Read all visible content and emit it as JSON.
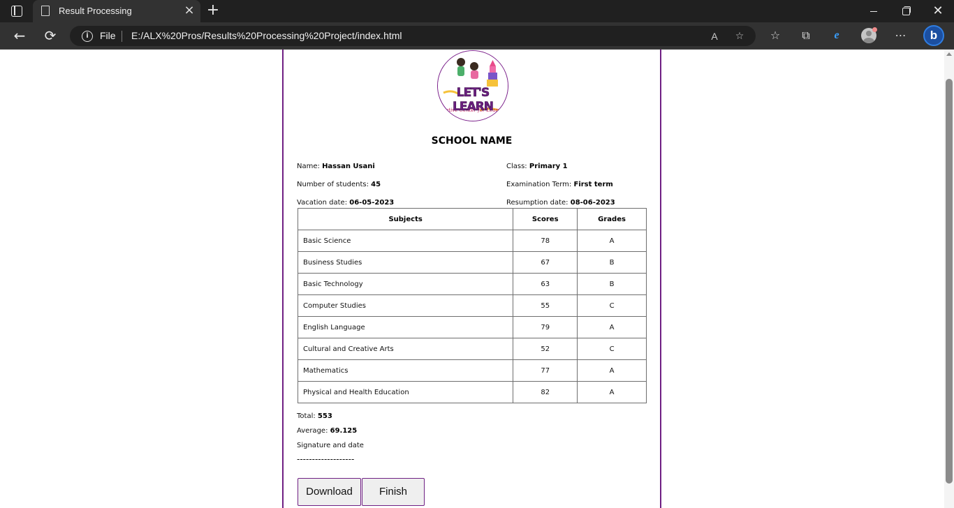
{
  "browser": {
    "tab_title": "Result Processing",
    "tab_close": "×",
    "new_tab": "+",
    "address_scheme": "File",
    "address_url": "E:/ALX%20Pros/Results%20Processing%20Project/index.html",
    "win_close": "✕",
    "icons": {
      "back": "←",
      "reload": "⟳",
      "info": "i",
      "read_aloud": "A",
      "favorite_add": "☆",
      "favorites": "☆",
      "collections": "⧉",
      "edge_ie": "e",
      "menu": "⋯",
      "bing": "b"
    }
  },
  "page": {
    "logo_text": "LET'S LEARN",
    "school_name": "SCHOOL NAME",
    "info": {
      "name_label": "Name:",
      "name_value": "Hassan Usani",
      "class_label": "Class:",
      "class_value": "Primary 1",
      "students_label": "Number of students:",
      "students_value": "45",
      "term_label": "Examination Term:",
      "term_value": "First term",
      "vacation_label": "Vacation date:",
      "vacation_value": "06-05-2023",
      "resumption_label": "Resumption date:",
      "resumption_value": "08-06-2023"
    },
    "table": {
      "headers": [
        "Subjects",
        "Scores",
        "Grades"
      ],
      "rows": [
        {
          "subject": "Basic Science",
          "score": "78",
          "grade": "A"
        },
        {
          "subject": "Business Studies",
          "score": "67",
          "grade": "B"
        },
        {
          "subject": "Basic Technology",
          "score": "63",
          "grade": "B"
        },
        {
          "subject": "Computer Studies",
          "score": "55",
          "grade": "C"
        },
        {
          "subject": "English Language",
          "score": "79",
          "grade": "A"
        },
        {
          "subject": "Cultural and Creative Arts",
          "score": "52",
          "grade": "C"
        },
        {
          "subject": "Mathematics",
          "score": "77",
          "grade": "A"
        },
        {
          "subject": "Physical and Health Education",
          "score": "82",
          "grade": "A"
        }
      ]
    },
    "summary": {
      "total_label": "Total:",
      "total_value": "553",
      "average_label": "Average:",
      "average_value": "69.125",
      "signature_label": "Signature and date",
      "signature_line": "-------------------"
    },
    "buttons": {
      "download": "Download",
      "finish": "Finish"
    }
  },
  "colors": {
    "accent": "#6f1f83",
    "chrome_dark": "#202020",
    "chrome_tab": "#323232"
  }
}
